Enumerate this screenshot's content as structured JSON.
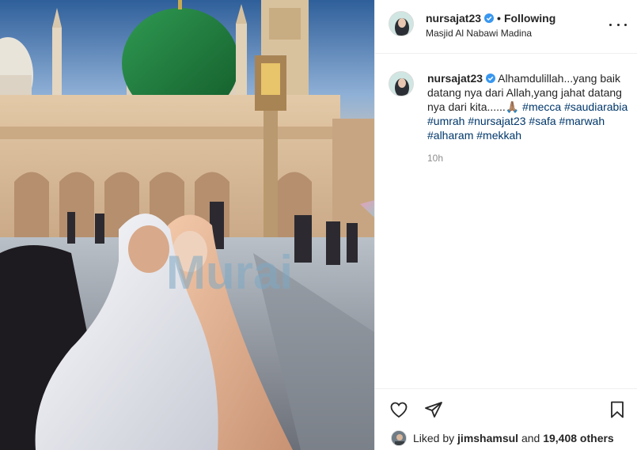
{
  "post": {
    "username": "nursajat23",
    "separator": "•",
    "follow_state": "Following",
    "location": "Masjid Al Nabawi Madina",
    "caption_text": "Alhamdulillah...yang baik datang nya dari Allah,yang jahat datang nya dari kita......🙏🏽",
    "caption_hashtags": "#mecca #saudiarabia #umrah #nursajat23 #safa #marwah #alharam #mekkah",
    "time_ago": "10h"
  },
  "likes": {
    "prefix": "Liked by",
    "first_liker": "jimshamsul",
    "conjunction": "and",
    "others": "19,408 others"
  },
  "watermark": {
    "text": "Murai"
  },
  "icons": {
    "verified": "verified-badge-icon",
    "more": "more-options-icon",
    "like": "heart-icon",
    "share": "paper-plane-icon",
    "save": "bookmark-icon"
  },
  "colors": {
    "verified_blue": "#3897f0",
    "hashtag_link": "#00376b",
    "muted_text": "#8e8e8e",
    "dome_green": "#1f7a3c"
  }
}
